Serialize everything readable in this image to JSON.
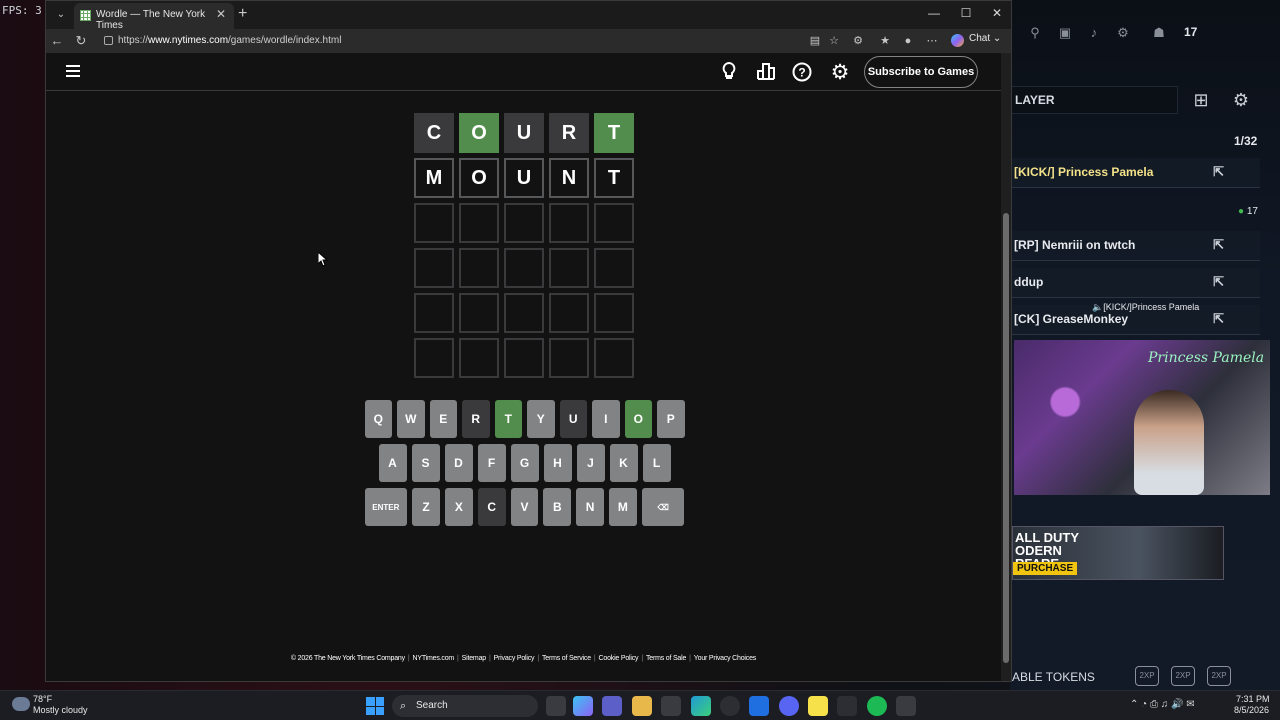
{
  "overlay": {
    "fps_label": "FPS: 3"
  },
  "side_panel": {
    "member_count": "17",
    "search_text": "LAYER",
    "page_indicator": "1/32",
    "online_count": "17",
    "rows": [
      {
        "label": "[KICK/] Princess Pamela",
        "highlight": true
      },
      {
        "label": "[RP] Nemriii on twtch",
        "highlight": false
      },
      {
        "label": "ddup",
        "highlight": false
      },
      {
        "label": "[CK] GreaseMonkey",
        "highlight": false
      }
    ],
    "speaking_label": "[KICK/]Princess Pamela",
    "webcam_name": "Princess Pamela",
    "ad": {
      "title": "ALL DUTY\nODERN\nRFARE",
      "cta": "PURCHASE"
    },
    "tokens_label": "ABLE TOKENS"
  },
  "browser": {
    "tab_title": "Wordle — The New York Times",
    "url_prefix": "https://",
    "url_domain": "www.nytimes.com",
    "url_path": "/games/wordle/index.html",
    "chat_label": "Chat"
  },
  "wordle": {
    "subscribe_label": "Subscribe to Games",
    "icons": [
      "lightbulb-icon",
      "stats-icon",
      "help-icon",
      "gear-icon"
    ],
    "board": [
      [
        {
          "letter": "C",
          "state": "absent"
        },
        {
          "letter": "O",
          "state": "correct"
        },
        {
          "letter": "U",
          "state": "absent"
        },
        {
          "letter": "R",
          "state": "absent"
        },
        {
          "letter": "T",
          "state": "correct"
        }
      ],
      [
        {
          "letter": "M",
          "state": "tbd"
        },
        {
          "letter": "O",
          "state": "tbd"
        },
        {
          "letter": "U",
          "state": "tbd"
        },
        {
          "letter": "N",
          "state": "tbd"
        },
        {
          "letter": "T",
          "state": "tbd"
        }
      ],
      [
        {
          "letter": "",
          "state": "empty"
        },
        {
          "letter": "",
          "state": "empty"
        },
        {
          "letter": "",
          "state": "empty"
        },
        {
          "letter": "",
          "state": "empty"
        },
        {
          "letter": "",
          "state": "empty"
        }
      ],
      [
        {
          "letter": "",
          "state": "empty"
        },
        {
          "letter": "",
          "state": "empty"
        },
        {
          "letter": "",
          "state": "empty"
        },
        {
          "letter": "",
          "state": "empty"
        },
        {
          "letter": "",
          "state": "empty"
        }
      ],
      [
        {
          "letter": "",
          "state": "empty"
        },
        {
          "letter": "",
          "state": "empty"
        },
        {
          "letter": "",
          "state": "empty"
        },
        {
          "letter": "",
          "state": "empty"
        },
        {
          "letter": "",
          "state": "empty"
        }
      ],
      [
        {
          "letter": "",
          "state": "empty"
        },
        {
          "letter": "",
          "state": "empty"
        },
        {
          "letter": "",
          "state": "empty"
        },
        {
          "letter": "",
          "state": "empty"
        },
        {
          "letter": "",
          "state": "empty"
        }
      ]
    ],
    "keyboard": [
      [
        {
          "key": "Q",
          "state": ""
        },
        {
          "key": "W",
          "state": ""
        },
        {
          "key": "E",
          "state": ""
        },
        {
          "key": "R",
          "state": "absent"
        },
        {
          "key": "T",
          "state": "correct"
        },
        {
          "key": "Y",
          "state": ""
        },
        {
          "key": "U",
          "state": "absent"
        },
        {
          "key": "I",
          "state": ""
        },
        {
          "key": "O",
          "state": "correct"
        },
        {
          "key": "P",
          "state": ""
        }
      ],
      [
        {
          "key": "A",
          "state": ""
        },
        {
          "key": "S",
          "state": ""
        },
        {
          "key": "D",
          "state": ""
        },
        {
          "key": "F",
          "state": ""
        },
        {
          "key": "G",
          "state": ""
        },
        {
          "key": "H",
          "state": ""
        },
        {
          "key": "J",
          "state": ""
        },
        {
          "key": "K",
          "state": ""
        },
        {
          "key": "L",
          "state": ""
        }
      ],
      [
        {
          "key": "ENTER",
          "state": "",
          "wide": true
        },
        {
          "key": "Z",
          "state": ""
        },
        {
          "key": "X",
          "state": ""
        },
        {
          "key": "C",
          "state": "absent"
        },
        {
          "key": "V",
          "state": ""
        },
        {
          "key": "B",
          "state": ""
        },
        {
          "key": "N",
          "state": ""
        },
        {
          "key": "M",
          "state": ""
        },
        {
          "key": "⌫",
          "state": "",
          "wide": true
        }
      ]
    ],
    "footer_links": [
      "© 2026 The New York Times Company",
      "NYTimes.com",
      "Sitemap",
      "Privacy Policy",
      "Terms of Service",
      "Cookie Policy",
      "Terms of Sale",
      "Your Privacy Choices"
    ]
  },
  "colors": {
    "correct": "#538d4e",
    "absent": "#3a3a3c",
    "key_default": "#818384",
    "background": "#121213"
  },
  "taskbar": {
    "weather_temp": "78°F",
    "weather_desc": "Mostly cloudy",
    "search_label": "Search",
    "time": "7:31 PM",
    "date": "8/5/2026"
  }
}
